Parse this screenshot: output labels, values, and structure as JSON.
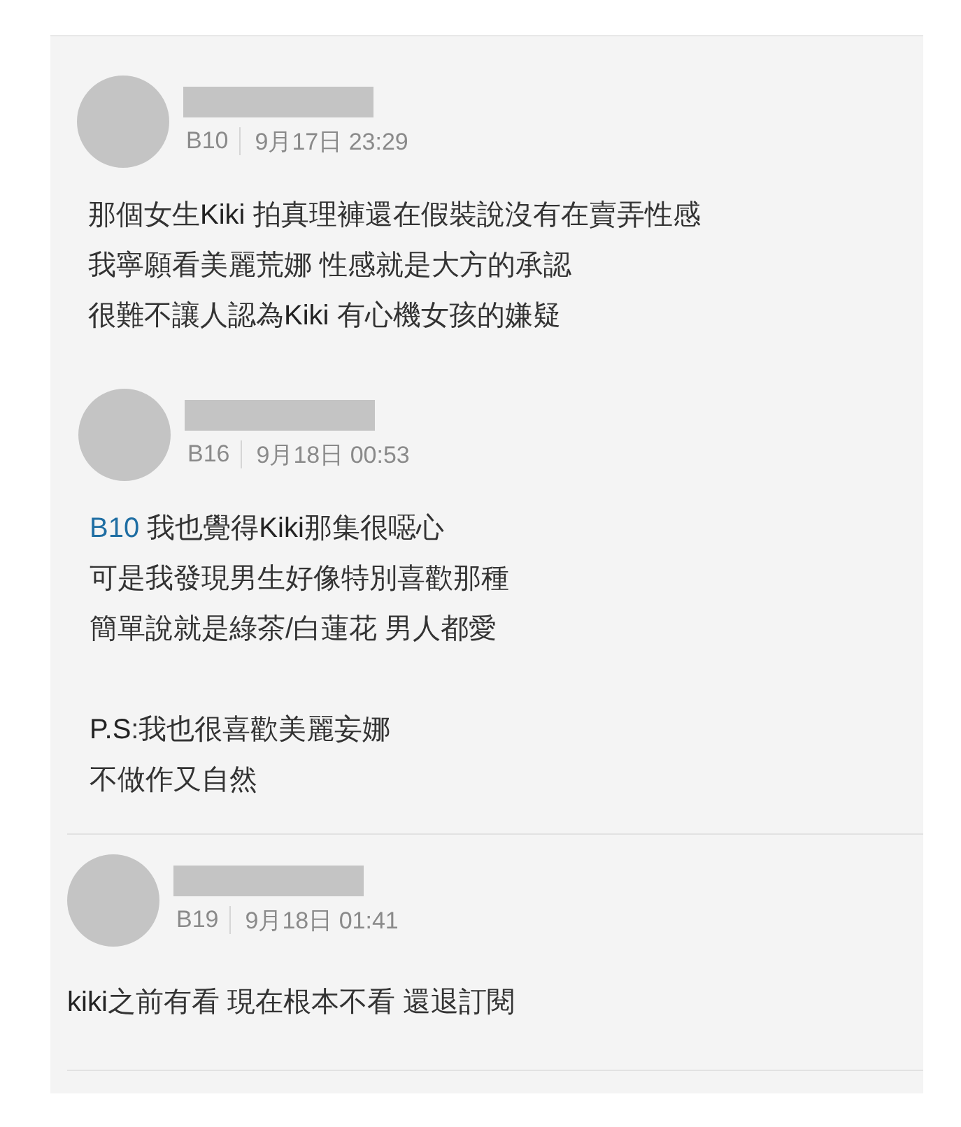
{
  "comments": [
    {
      "floor": "B10",
      "time": "9月17日 23:29",
      "divider_below": false,
      "paragraphs": [
        [
          "那個女生**Kiki** 拍真理褲還在假裝說沒有在賣弄性感",
          "我寧願看美麗荒娜 性感就是大方的承認",
          "很難不讓人認為**Kiki** 有心機女孩的嫌疑"
        ]
      ]
    },
    {
      "floor": "B16",
      "time": "9月18日 00:53",
      "divider_below": true,
      "mention": "B10",
      "paragraphs": [
        [
          " 我也覺得**Kiki**那集很噁心",
          "可是我發現男生好像特別喜歡那種",
          "簡單說就是綠茶/白蓮花 男人都愛"
        ],
        [
          "**P.S**:我也很喜歡美麗妄娜",
          "不做作又自然"
        ]
      ]
    },
    {
      "floor": "B19",
      "time": "9月18日 01:41",
      "divider_below": true,
      "paragraphs": [
        [
          "**kiki**之前有看 現在根本不看 還退訂閱"
        ]
      ]
    }
  ]
}
